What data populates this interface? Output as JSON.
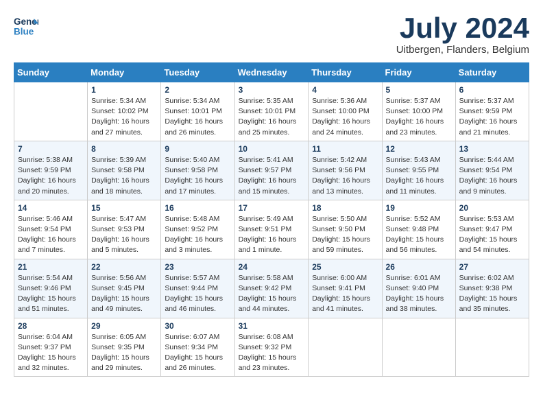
{
  "header": {
    "logo_line1": "General",
    "logo_line2": "Blue",
    "month_title": "July 2024",
    "location": "Uitbergen, Flanders, Belgium"
  },
  "weekdays": [
    "Sunday",
    "Monday",
    "Tuesday",
    "Wednesday",
    "Thursday",
    "Friday",
    "Saturday"
  ],
  "weeks": [
    [
      {
        "day": "",
        "sunrise": "",
        "sunset": "",
        "daylight": ""
      },
      {
        "day": "1",
        "sunrise": "Sunrise: 5:34 AM",
        "sunset": "Sunset: 10:02 PM",
        "daylight": "Daylight: 16 hours and 27 minutes."
      },
      {
        "day": "2",
        "sunrise": "Sunrise: 5:34 AM",
        "sunset": "Sunset: 10:01 PM",
        "daylight": "Daylight: 16 hours and 26 minutes."
      },
      {
        "day": "3",
        "sunrise": "Sunrise: 5:35 AM",
        "sunset": "Sunset: 10:01 PM",
        "daylight": "Daylight: 16 hours and 25 minutes."
      },
      {
        "day": "4",
        "sunrise": "Sunrise: 5:36 AM",
        "sunset": "Sunset: 10:00 PM",
        "daylight": "Daylight: 16 hours and 24 minutes."
      },
      {
        "day": "5",
        "sunrise": "Sunrise: 5:37 AM",
        "sunset": "Sunset: 10:00 PM",
        "daylight": "Daylight: 16 hours and 23 minutes."
      },
      {
        "day": "6",
        "sunrise": "Sunrise: 5:37 AM",
        "sunset": "Sunset: 9:59 PM",
        "daylight": "Daylight: 16 hours and 21 minutes."
      }
    ],
    [
      {
        "day": "7",
        "sunrise": "Sunrise: 5:38 AM",
        "sunset": "Sunset: 9:59 PM",
        "daylight": "Daylight: 16 hours and 20 minutes."
      },
      {
        "day": "8",
        "sunrise": "Sunrise: 5:39 AM",
        "sunset": "Sunset: 9:58 PM",
        "daylight": "Daylight: 16 hours and 18 minutes."
      },
      {
        "day": "9",
        "sunrise": "Sunrise: 5:40 AM",
        "sunset": "Sunset: 9:58 PM",
        "daylight": "Daylight: 16 hours and 17 minutes."
      },
      {
        "day": "10",
        "sunrise": "Sunrise: 5:41 AM",
        "sunset": "Sunset: 9:57 PM",
        "daylight": "Daylight: 16 hours and 15 minutes."
      },
      {
        "day": "11",
        "sunrise": "Sunrise: 5:42 AM",
        "sunset": "Sunset: 9:56 PM",
        "daylight": "Daylight: 16 hours and 13 minutes."
      },
      {
        "day": "12",
        "sunrise": "Sunrise: 5:43 AM",
        "sunset": "Sunset: 9:55 PM",
        "daylight": "Daylight: 16 hours and 11 minutes."
      },
      {
        "day": "13",
        "sunrise": "Sunrise: 5:44 AM",
        "sunset": "Sunset: 9:54 PM",
        "daylight": "Daylight: 16 hours and 9 minutes."
      }
    ],
    [
      {
        "day": "14",
        "sunrise": "Sunrise: 5:46 AM",
        "sunset": "Sunset: 9:54 PM",
        "daylight": "Daylight: 16 hours and 7 minutes."
      },
      {
        "day": "15",
        "sunrise": "Sunrise: 5:47 AM",
        "sunset": "Sunset: 9:53 PM",
        "daylight": "Daylight: 16 hours and 5 minutes."
      },
      {
        "day": "16",
        "sunrise": "Sunrise: 5:48 AM",
        "sunset": "Sunset: 9:52 PM",
        "daylight": "Daylight: 16 hours and 3 minutes."
      },
      {
        "day": "17",
        "sunrise": "Sunrise: 5:49 AM",
        "sunset": "Sunset: 9:51 PM",
        "daylight": "Daylight: 16 hours and 1 minute."
      },
      {
        "day": "18",
        "sunrise": "Sunrise: 5:50 AM",
        "sunset": "Sunset: 9:50 PM",
        "daylight": "Daylight: 15 hours and 59 minutes."
      },
      {
        "day": "19",
        "sunrise": "Sunrise: 5:52 AM",
        "sunset": "Sunset: 9:48 PM",
        "daylight": "Daylight: 15 hours and 56 minutes."
      },
      {
        "day": "20",
        "sunrise": "Sunrise: 5:53 AM",
        "sunset": "Sunset: 9:47 PM",
        "daylight": "Daylight: 15 hours and 54 minutes."
      }
    ],
    [
      {
        "day": "21",
        "sunrise": "Sunrise: 5:54 AM",
        "sunset": "Sunset: 9:46 PM",
        "daylight": "Daylight: 15 hours and 51 minutes."
      },
      {
        "day": "22",
        "sunrise": "Sunrise: 5:56 AM",
        "sunset": "Sunset: 9:45 PM",
        "daylight": "Daylight: 15 hours and 49 minutes."
      },
      {
        "day": "23",
        "sunrise": "Sunrise: 5:57 AM",
        "sunset": "Sunset: 9:44 PM",
        "daylight": "Daylight: 15 hours and 46 minutes."
      },
      {
        "day": "24",
        "sunrise": "Sunrise: 5:58 AM",
        "sunset": "Sunset: 9:42 PM",
        "daylight": "Daylight: 15 hours and 44 minutes."
      },
      {
        "day": "25",
        "sunrise": "Sunrise: 6:00 AM",
        "sunset": "Sunset: 9:41 PM",
        "daylight": "Daylight: 15 hours and 41 minutes."
      },
      {
        "day": "26",
        "sunrise": "Sunrise: 6:01 AM",
        "sunset": "Sunset: 9:40 PM",
        "daylight": "Daylight: 15 hours and 38 minutes."
      },
      {
        "day": "27",
        "sunrise": "Sunrise: 6:02 AM",
        "sunset": "Sunset: 9:38 PM",
        "daylight": "Daylight: 15 hours and 35 minutes."
      }
    ],
    [
      {
        "day": "28",
        "sunrise": "Sunrise: 6:04 AM",
        "sunset": "Sunset: 9:37 PM",
        "daylight": "Daylight: 15 hours and 32 minutes."
      },
      {
        "day": "29",
        "sunrise": "Sunrise: 6:05 AM",
        "sunset": "Sunset: 9:35 PM",
        "daylight": "Daylight: 15 hours and 29 minutes."
      },
      {
        "day": "30",
        "sunrise": "Sunrise: 6:07 AM",
        "sunset": "Sunset: 9:34 PM",
        "daylight": "Daylight: 15 hours and 26 minutes."
      },
      {
        "day": "31",
        "sunrise": "Sunrise: 6:08 AM",
        "sunset": "Sunset: 9:32 PM",
        "daylight": "Daylight: 15 hours and 23 minutes."
      },
      {
        "day": "",
        "sunrise": "",
        "sunset": "",
        "daylight": ""
      },
      {
        "day": "",
        "sunrise": "",
        "sunset": "",
        "daylight": ""
      },
      {
        "day": "",
        "sunrise": "",
        "sunset": "",
        "daylight": ""
      }
    ]
  ]
}
